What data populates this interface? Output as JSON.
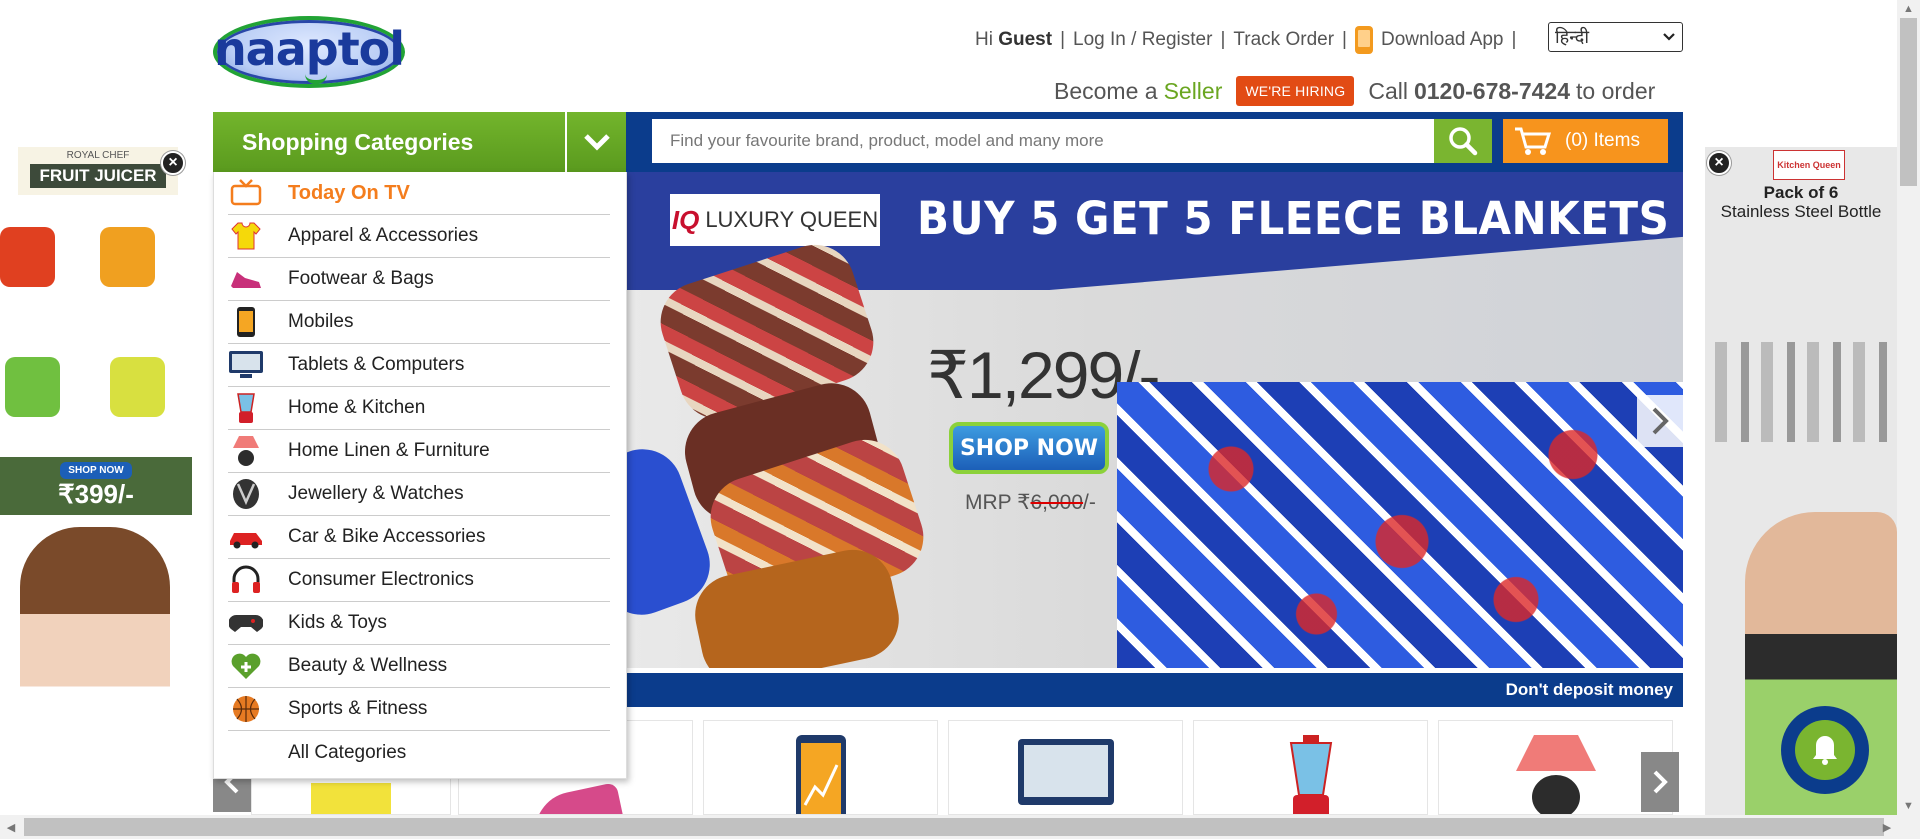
{
  "header": {
    "logo_text": "naaptol",
    "greeting_prefix": "Hi",
    "greeting_user": "Guest",
    "login_link": "Log In / Register",
    "track_order": "Track Order",
    "download_app": "Download App",
    "language_selected": "हिन्दी",
    "become_prefix": "Become a",
    "become_seller": "Seller",
    "hiring_badge": "WE'RE HIRING",
    "call_prefix": "Call",
    "phone": "0120-678-7424",
    "call_suffix": "to order"
  },
  "nav": {
    "categories_label": "Shopping Categories",
    "search_placeholder": "Find your favourite brand, product, model and many more",
    "cart_label": "(0) Items"
  },
  "categories": [
    {
      "label": "Today On TV",
      "icon": "tv-icon"
    },
    {
      "label": "Apparel & Accessories",
      "icon": "tshirt-icon"
    },
    {
      "label": "Footwear & Bags",
      "icon": "shoe-icon"
    },
    {
      "label": "Mobiles",
      "icon": "mobile-icon"
    },
    {
      "label": "Tablets & Computers",
      "icon": "monitor-icon"
    },
    {
      "label": "Home & Kitchen",
      "icon": "blender-icon"
    },
    {
      "label": "Home Linen & Furniture",
      "icon": "lamp-icon"
    },
    {
      "label": "Jewellery & Watches",
      "icon": "necklace-icon"
    },
    {
      "label": "Car & Bike Accessories",
      "icon": "car-icon"
    },
    {
      "label": "Consumer Electronics",
      "icon": "headphones-icon"
    },
    {
      "label": "Kids & Toys",
      "icon": "gamepad-icon"
    },
    {
      "label": "Beauty & Wellness",
      "icon": "heart-plus-icon"
    },
    {
      "label": "Sports & Fitness",
      "icon": "basketball-icon"
    },
    {
      "label": "All Categories",
      "icon": ""
    }
  ],
  "banner": {
    "brand": "LUXURY QUEEN",
    "brand_mark": "IQ",
    "headline": "BUY 5 GET 5 FLEECE BLANKETS",
    "price": "₹1,299/-",
    "cta": "SHOP NOW",
    "mrp_prefix": "MRP ₹",
    "mrp_value": "6,000",
    "mrp_suffix": "/-"
  },
  "strip_text": "Don't deposit money",
  "ads": {
    "left": {
      "brand": "ROYAL CHEF",
      "title": "FRUIT JUICER",
      "cta": "SHOP NOW",
      "price": "₹399/-"
    },
    "right": {
      "brand": "Kitchen Queen",
      "title_line1": "Pack of 6",
      "title_line2": "Stainless Steel Bottle"
    }
  },
  "colors": {
    "brand_green": "#7ab530",
    "brand_blue": "#0b3c8c",
    "accent_orange": "#f7941d",
    "hiring_red": "#e24b14"
  }
}
